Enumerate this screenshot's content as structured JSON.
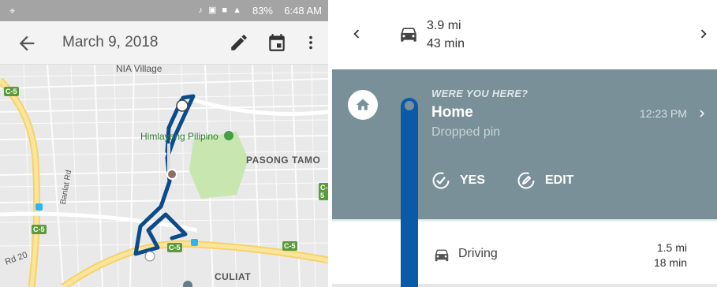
{
  "statusbar": {
    "left_icon": "location-icon",
    "battery": "83%",
    "time": "6:48 AM"
  },
  "appbar": {
    "date": "March 9, 2018",
    "back_icon": "arrow-back-icon",
    "edit_icon": "pencil-icon",
    "calendar_icon": "calendar-icon",
    "more_icon": "more-vert-icon"
  },
  "map": {
    "labels": {
      "nia_village": "NIA Village",
      "himlayang": "Himlayang Pilipino",
      "pasong_tamo": "PASONG TAMO",
      "culiat": "CULIAT",
      "banlat_rd": "Banlat Rd",
      "rd20": "Rd 20"
    },
    "road_badge": "C-5",
    "route_color": "#0b4a8b"
  },
  "trip": {
    "distance": "3.9 mi",
    "duration": "43 min",
    "prev_icon": "chevron-left-icon",
    "next_icon": "chevron-right-icon"
  },
  "visit": {
    "question": "WERE YOU HERE?",
    "place": "Home",
    "subtitle": "Dropped pin",
    "time": "12:23 PM",
    "yes_label": "YES",
    "edit_label": "EDIT",
    "card_color": "#7a9098"
  },
  "segment": {
    "label": "Driving",
    "distance": "1.5 mi",
    "duration": "18 min"
  },
  "colors": {
    "accent": "#0b5aa8",
    "park": "#c8e6b0"
  }
}
